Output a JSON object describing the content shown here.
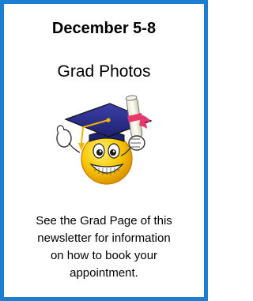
{
  "notice": {
    "date_range": "December 5-8",
    "event": "Grad Photos",
    "details": "See the Grad  Page of this\nnewsletter for information\non how to book your\nappointment."
  },
  "illustration": {
    "icon": "graduate-smiley-icon",
    "description_colors": {
      "border": "#1e7fd0",
      "cap": "#2b2f8f",
      "face": "#f5c400",
      "ribbon": "#e8396b"
    }
  }
}
